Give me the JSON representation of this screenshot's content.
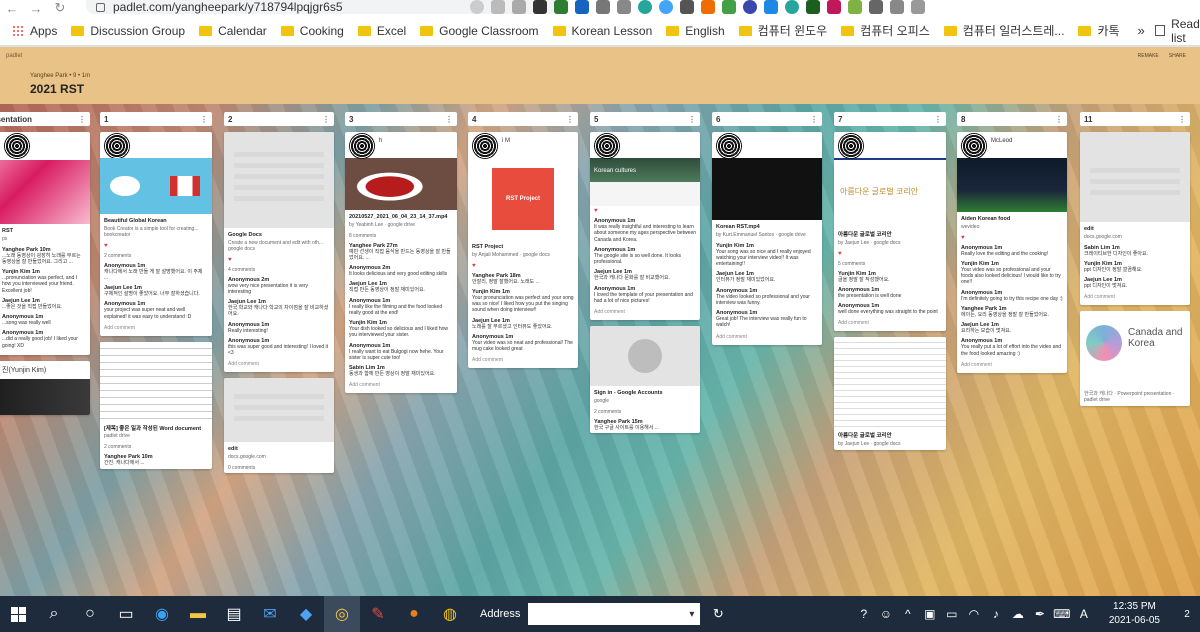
{
  "browser": {
    "url": "padlet.com/yangheepark/y718794lpqjgr6s5",
    "bookmarks": [
      "Apps",
      "Discussion Group",
      "Calendar",
      "Cooking",
      "Excel",
      "Google Classroom",
      "Korean Lesson",
      "English",
      "컴퓨터 윈도우",
      "컴퓨터 오피스",
      "컴퓨터 일러스트레...",
      "카톡"
    ],
    "more": "»",
    "reading_list": "Reading list"
  },
  "padlet": {
    "brand": "padlet",
    "author": "Yanghee Park • 9 • 1m",
    "title": "2021 RST",
    "actions": [
      "REMAKE",
      "SHARE"
    ]
  },
  "columns": [
    {
      "header": "presentation",
      "cards": [
        {
          "author": "",
          "title": "RST",
          "sub": "ps",
          "hearts": "",
          "comments_count": "",
          "comments": [
            {
              "name": "Yanghee Park 10m",
              "text": "...노래 동영상이 굉장히 노래를 부르는 동영상을 잘 만들었어요. 그리고 ..."
            },
            {
              "name": "Yunjin Kim 1m",
              "text": "...pronunciation was perfect, and I how you interviewed your friend. Excellent job!"
            },
            {
              "name": "Jaejun Lee 1m",
              "text": "...좋은 것을 직접 만들었어요."
            },
            {
              "name": "Anonymous 1m",
              "text": "...song was really well"
            },
            {
              "name": "Anonymous 1m",
              "text": "...did a really good job! I liked your going! XD"
            }
          ]
        },
        {
          "author": "진(Yunjin Kim)",
          "title": "",
          "sub": "",
          "hearts": "",
          "comments_count": "",
          "comments": []
        }
      ]
    },
    {
      "header": "1",
      "cards": [
        {
          "author": "",
          "title": "Beautiful Global Korean",
          "sub": "Book Creator is a simple tool for creating... bookcreator",
          "hearts": "♥",
          "comments_count": "2 comments",
          "comments": [
            {
              "name": "Anonymous 1m",
              "text": "캐나다에서 노래 만들 게 잘 설명했어요. 이 주제 ..."
            },
            {
              "name": "Jaejun Lee 1m",
              "text": "구체적인 설명이 좋았어요. 너무 잘하셨습니다."
            },
            {
              "name": "Anonymous 1m",
              "text": "your project was super neat and well explained! it was easy to understand :D"
            }
          ]
        },
        {
          "author": "",
          "title": "[제목] 좋은 일과 작성된 Word document",
          "sub": "padlet drive",
          "hearts": "",
          "comments_count": "2 comments",
          "comments": [
            {
              "name": "Yanghee Park 10m",
              "text": "간진. 캐나다에서 ..."
            }
          ]
        }
      ]
    },
    {
      "header": "2",
      "cards": [
        {
          "author": "",
          "title": "Google Docs",
          "sub": "Create a new document and edit with oth... google docs",
          "hearts": "♥",
          "comments_count": "4 comments",
          "comments": [
            {
              "name": "Anonymous 2m",
              "text": "wow very nice presentation it is very interesting"
            },
            {
              "name": "Jaejun Lee 1m",
              "text": "한국 학교와 캐나다 학교의 차이점을 잘 비교하셨어요."
            },
            {
              "name": "Anonymous 1m",
              "text": "Really interesting!"
            },
            {
              "name": "Anonymous 1m",
              "text": "this was super good and interesting! I loved it <3"
            }
          ]
        },
        {
          "author": "",
          "title": "edit",
          "sub": "docs.google.com",
          "hearts": "",
          "comments_count": "0 comments",
          "comments": []
        }
      ]
    },
    {
      "header": "3",
      "cards": [
        {
          "author": "h",
          "title": "20210527_2021_06_04_23_14_37.mp4",
          "sub": "by Yeabinh Lee · google drive",
          "hearts": "",
          "comments_count": "8 comments",
          "comments": [
            {
              "name": "Yanghee Park 27m",
              "text": "예빈 선생이 직접 음식을 만드는 동영상을 잘 만들었어요. ..."
            },
            {
              "name": "Anonymous 2m",
              "text": "It looks delicious and very good editing skills"
            },
            {
              "name": "Jaejun Lee 1m",
              "text": "직접 만든 동영상이 정말 재미있어요."
            },
            {
              "name": "Anonymous 1m",
              "text": "I really like the filming and the food looked really good at the end!"
            },
            {
              "name": "Yunjin Kim 1m",
              "text": "Your dish looked so delicious and I liked how you interviewed your sister."
            },
            {
              "name": "Anonymous 1m",
              "text": "I really want to eat Bulgogi now hehe. Your sister is super cute too!"
            },
            {
              "name": "Sabin Lim 1m",
              "text": "동생과 함께 만든 영상이 정말 재미있어요."
            }
          ]
        }
      ]
    },
    {
      "header": "4",
      "cards": [
        {
          "author": "i M",
          "title": "RST Project",
          "sub": "by Anjali Mohammed · google docs",
          "hearts": "♥",
          "comments_count": "",
          "comments": [
            {
              "name": "Yanghee Park 18m",
              "text": "안잘리, 정말 잘했어요. 노래도 ..."
            },
            {
              "name": "Yunjin Kim 1m",
              "text": "Your pronunciation was perfect and your song was so nice! I liked how you put the singing sound when doing interview!!"
            },
            {
              "name": "Jaejun Lee 1m",
              "text": "노래를 잘 부르셨고 인터뷰도 좋았어요."
            },
            {
              "name": "Anonymous 1m",
              "text": "Your video was so neat and professional! The mug cake looked great"
            }
          ]
        }
      ]
    },
    {
      "header": "5",
      "cards": [
        {
          "author": "",
          "title": "Korean cultures",
          "sub": "",
          "hearts": "♥",
          "comments_count": "",
          "comments": [
            {
              "name": "Anonymous 1m",
              "text": "It was really insightful and interesting to learn about someone my ages perspective between Canada and Korea."
            },
            {
              "name": "Anonymous 1m",
              "text": "The google site is so well done. It looks professional."
            },
            {
              "name": "Jaejun Lee 1m",
              "text": "한국과 캐나다 문화를 잘 비교했어요."
            },
            {
              "name": "Anonymous 1m",
              "text": "I loved the template of your presentation and had a lot of nice pictures!"
            }
          ]
        },
        {
          "author": "",
          "title": "Sign in - Google Accounts",
          "sub": "google",
          "hearts": "",
          "comments_count": "2 comments",
          "comments": [
            {
              "name": "Yanghee Park 15m",
              "text": "한국 구글 사이트를 이용해서 ..."
            }
          ]
        }
      ]
    },
    {
      "header": "6",
      "cards": [
        {
          "author": "",
          "title": "Korean RST.mp4",
          "sub": "by Kurt.Emmanuel Santos · google drive",
          "hearts": "",
          "comments_count": "",
          "comments": [
            {
              "name": "Yunjin Kim 1m",
              "text": "Your song was so nice and I really enjoyed watching your interview video!! It was entertaining!!"
            },
            {
              "name": "Jaejun Lee 1m",
              "text": "인터뷰가 정말 재미있었어요."
            },
            {
              "name": "Anonymous 1m",
              "text": "The video looked so professional and your interview was funny."
            },
            {
              "name": "Anonymous 1m",
              "text": "Great job! The interview was really fun to watch!"
            }
          ]
        }
      ]
    },
    {
      "header": "7",
      "cards": [
        {
          "author": "",
          "title": "아름다운 글로벌 코리안",
          "sub": "by Jaejun Lee · google docs",
          "hearts": "♥",
          "comments_count": "5 comments",
          "comments": [
            {
              "name": "Yunjin Kim 1m",
              "text": "글을 정말 잘 작성했어요."
            },
            {
              "name": "Anonymous 1m",
              "text": "the presentation is well done"
            },
            {
              "name": "Anonymous 1m",
              "text": "well done everything was straight to the point"
            }
          ]
        },
        {
          "author": "",
          "title": "아름다운 글로벌 코리안",
          "sub": "by Jaejun Lee · google docs",
          "hearts": "",
          "comments_count": "",
          "comments": []
        }
      ]
    },
    {
      "header": "8",
      "cards": [
        {
          "author": "McLeod",
          "title": "Aiden Korean food",
          "sub": "wevideo",
          "hearts": "♥",
          "comments_count": "",
          "comments": [
            {
              "name": "Anonymous 1m",
              "text": "Really love the editing and the cooking!"
            },
            {
              "name": "Yunjin Kim 1m",
              "text": "Your video was so professional and your foods also looked delicious! I would like to try one!!"
            },
            {
              "name": "Anonymous 1m",
              "text": "I'm definitely going to try this recipe one day :)"
            },
            {
              "name": "Yanghee Park 1m",
              "text": "에이든, 요리 동영상을 정말 잘 만들었어요."
            },
            {
              "name": "Jaejun Lee 1m",
              "text": "요리하는 모습이 멋져요."
            },
            {
              "name": "Anonymous 1m",
              "text": "You really put a lot of effort into the video and the food looked amazing :)"
            }
          ]
        }
      ]
    },
    {
      "header": "11",
      "cards": [
        {
          "author": "",
          "title": "edit",
          "sub": "docs.google.com",
          "hearts": "",
          "comments_count": "",
          "comments": [
            {
              "name": "Sabin Lim 1m",
              "text": "크레이티브한 디자인이 좋아요."
            },
            {
              "name": "Yunjin Kim 1m",
              "text": "ppt 디자인이 정말 깔끔해요."
            },
            {
              "name": "Jaejun Lee 1m",
              "text": "ppt 디자인이 멋져요."
            }
          ]
        },
        {
          "author": "",
          "title": "Canada and Korea",
          "sub": "한국과 캐나다 · Powerpoint presentation · padlet drive",
          "hearts": "",
          "comments_count": "",
          "comments": []
        }
      ]
    }
  ],
  "taskbar": {
    "address_label": "Address",
    "time": "12:35 PM",
    "date": "2021-06-05",
    "notifications": "2"
  }
}
